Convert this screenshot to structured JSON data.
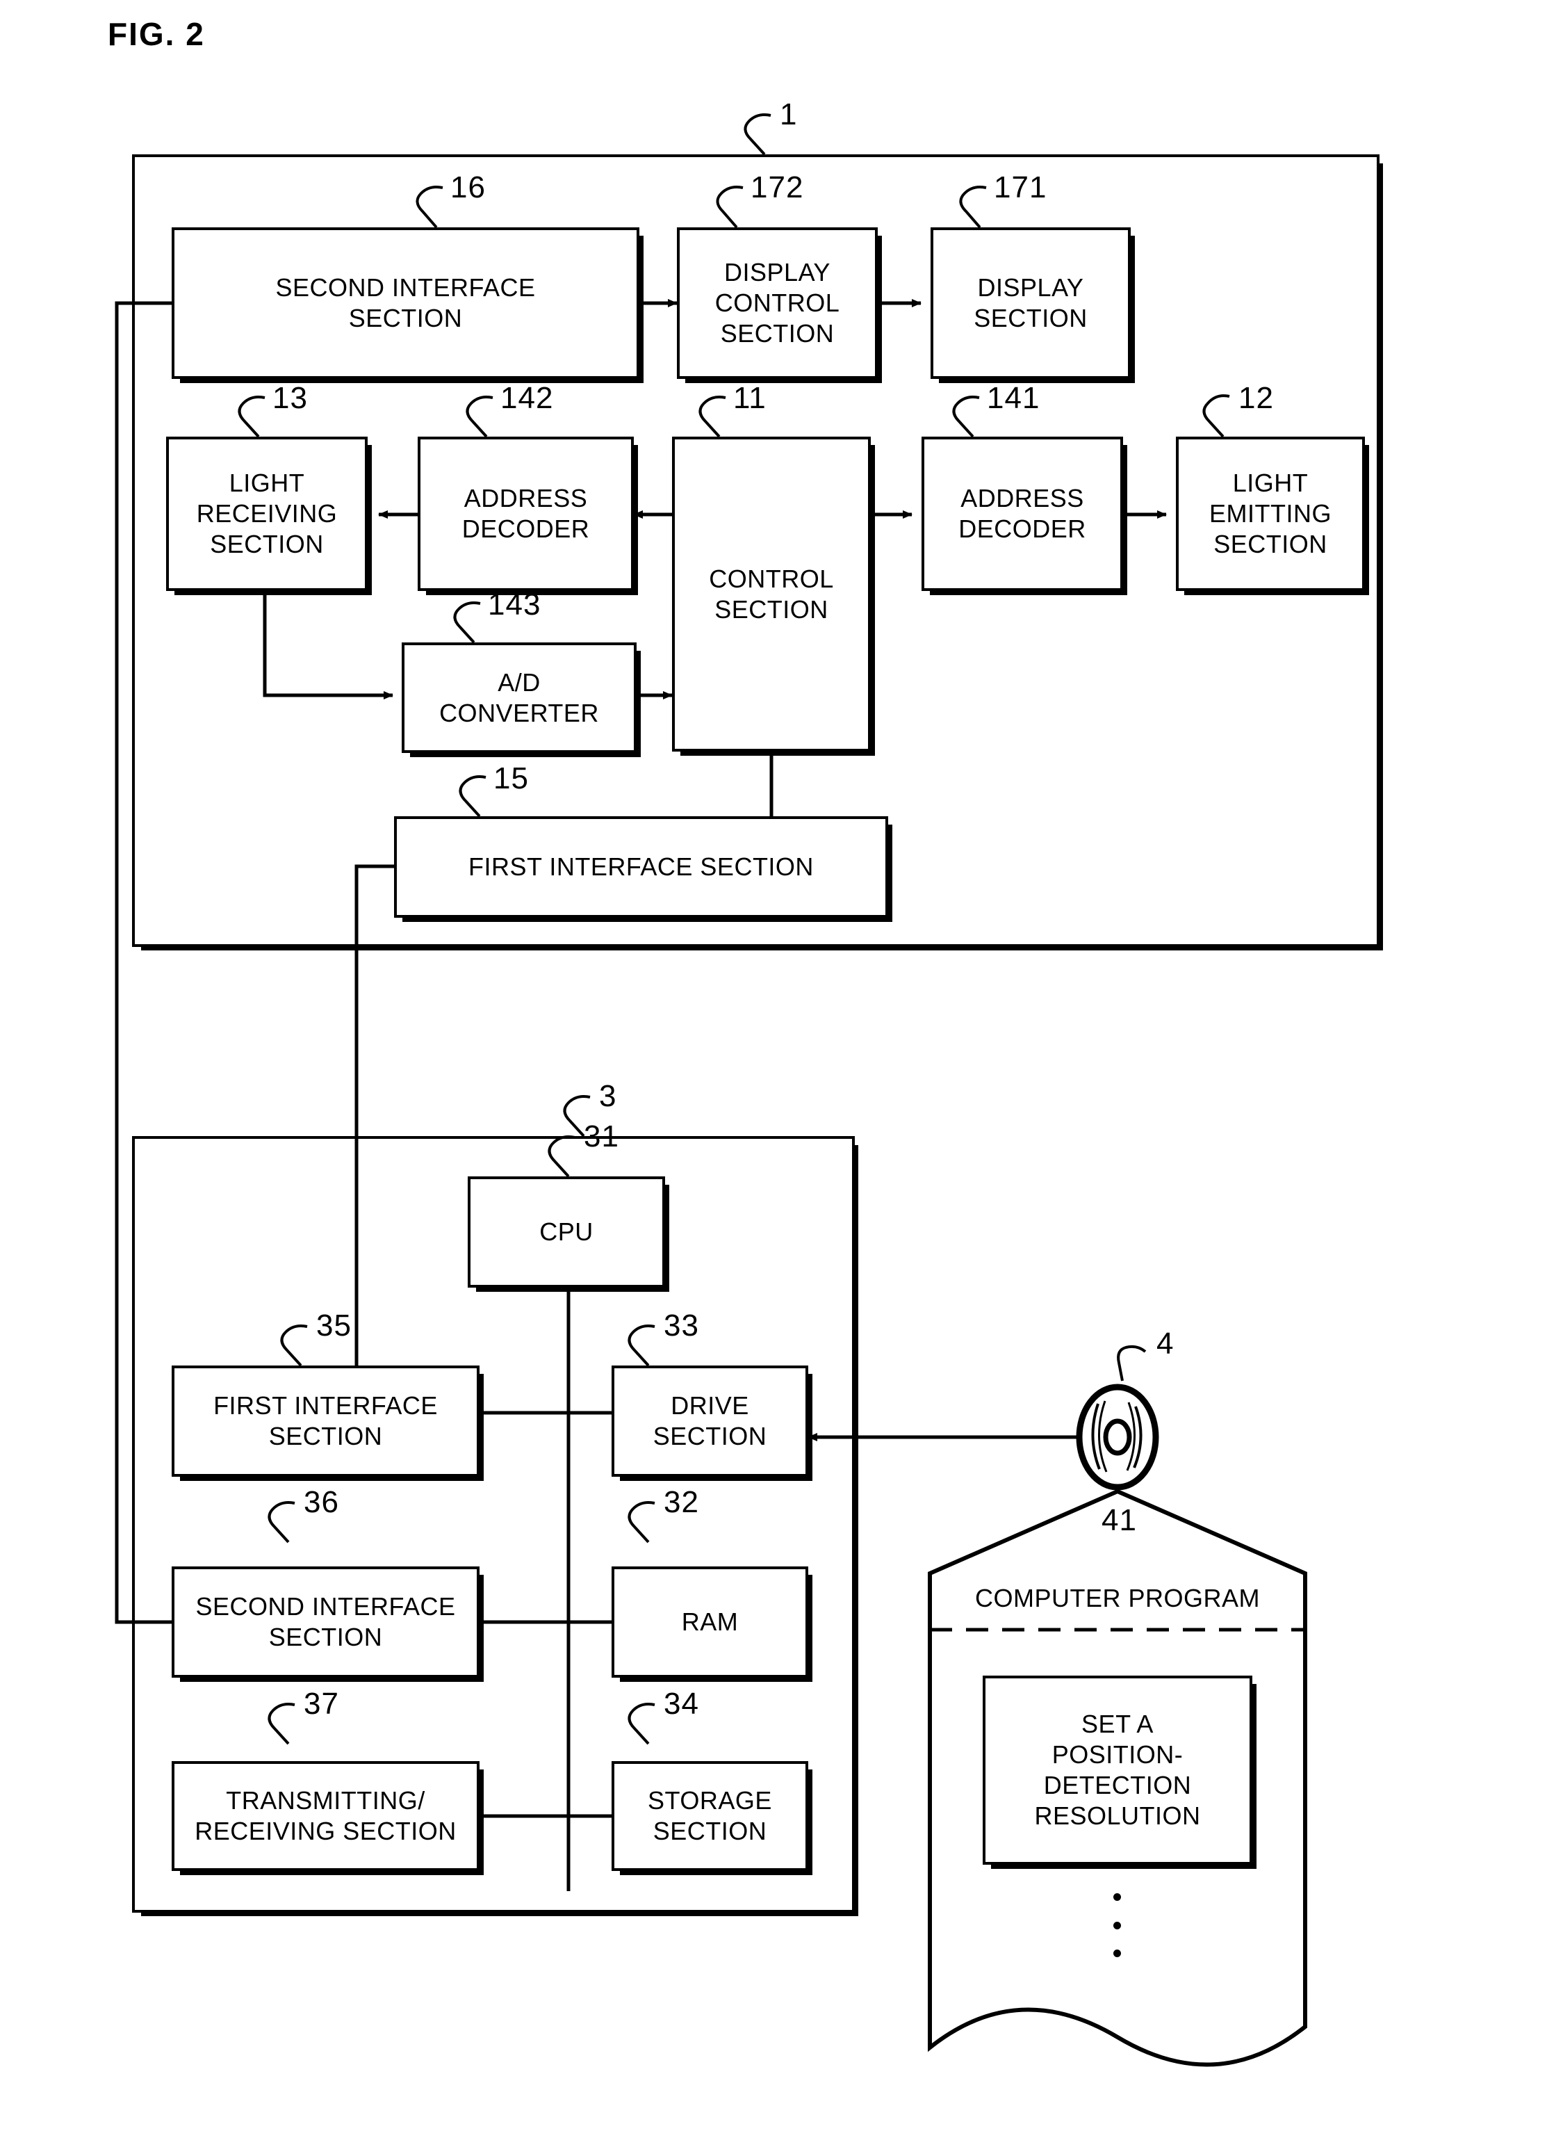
{
  "figure": {
    "title": "FIG. 2"
  },
  "blocks": {
    "second_interface_section_1": {
      "label": "SECOND INTERFACE\nSECTION",
      "ref": "16"
    },
    "display_control_section": {
      "label": "DISPLAY\nCONTROL\nSECTION",
      "ref": "172"
    },
    "display_section": {
      "label": "DISPLAY\nSECTION",
      "ref": "171"
    },
    "light_receiving_section": {
      "label": "LIGHT\nRECEIVING\nSECTION",
      "ref": "13"
    },
    "address_decoder_142": {
      "label": "ADDRESS\nDECODER",
      "ref": "142"
    },
    "control_section": {
      "label": "CONTROL\nSECTION",
      "ref": "11"
    },
    "address_decoder_141": {
      "label": "ADDRESS\nDECODER",
      "ref": "141"
    },
    "light_emitting_section": {
      "label": "LIGHT\nEMITTING\nSECTION",
      "ref": "12"
    },
    "ad_converter": {
      "label": "A/D\nCONVERTER",
      "ref": "143"
    },
    "first_interface_section_1": {
      "label": "FIRST INTERFACE SECTION",
      "ref": "15"
    },
    "cpu": {
      "label": "CPU",
      "ref": "31"
    },
    "first_interface_section_3": {
      "label": "FIRST INTERFACE\nSECTION",
      "ref": "35"
    },
    "drive_section": {
      "label": "DRIVE\nSECTION",
      "ref": "33"
    },
    "second_interface_section_3": {
      "label": "SECOND INTERFACE\nSECTION",
      "ref": "36"
    },
    "ram": {
      "label": "RAM",
      "ref": "32"
    },
    "transmitting_receiving_section": {
      "label": "TRANSMITTING/\nRECEIVING SECTION",
      "ref": "37"
    },
    "storage_section": {
      "label": "STORAGE\nSECTION",
      "ref": "34"
    },
    "set_resolution_step": {
      "label": "SET A\nPOSITION-\nDETECTION\nRESOLUTION"
    }
  },
  "containers": {
    "device_unit": {
      "ref": "1"
    },
    "computer_unit": {
      "ref": "3"
    },
    "recording_medium": {
      "ref": "4"
    },
    "computer_program": {
      "ref": "41",
      "title": "COMPUTER PROGRAM"
    }
  },
  "colors": {
    "line": "#000000",
    "background": "#ffffff"
  }
}
